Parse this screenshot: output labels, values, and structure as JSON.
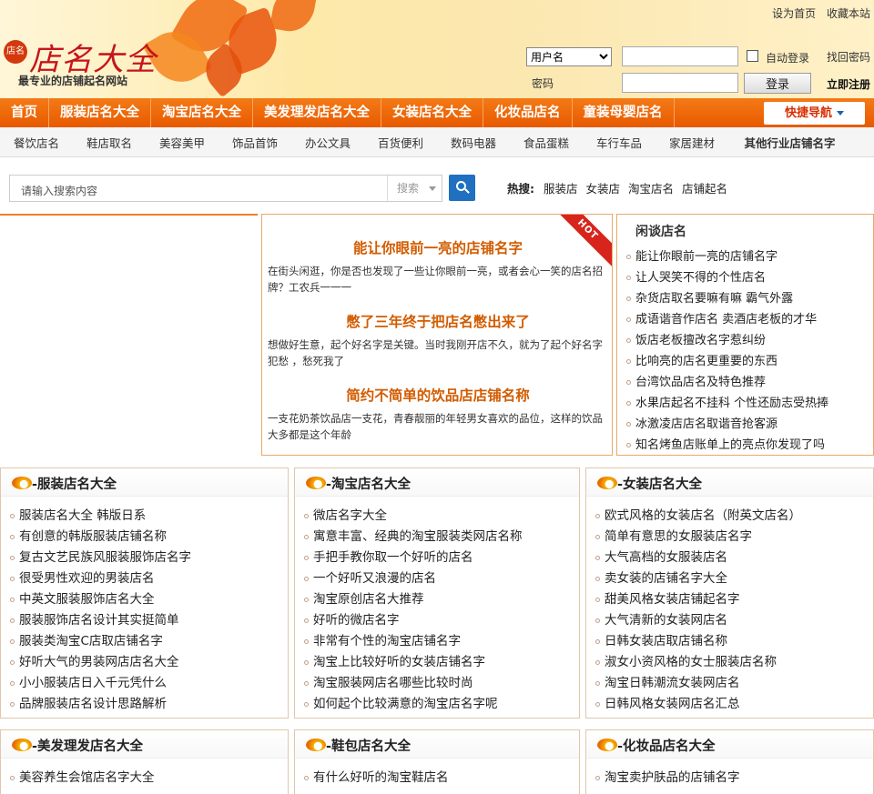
{
  "header": {
    "top_links": [
      "设为首页",
      "收藏本站"
    ],
    "logo": {
      "badge": "店名",
      "title": "店名大全",
      "slogan": "最专业的店铺起名网站"
    },
    "login": {
      "username_select": "用户名",
      "password_label": "密码",
      "auto_login": "自动登录",
      "forgot": "找回密码",
      "login_button": "登录",
      "register": "立即注册"
    }
  },
  "main_nav": {
    "items": [
      "首页",
      "服装店名大全",
      "淘宝店名大全",
      "美发理发店名大全",
      "女装店名大全",
      "化妆品店名",
      "童装母婴店名"
    ],
    "quick_nav": "快捷导航"
  },
  "sub_nav": [
    "餐饮店名",
    "鞋店取名",
    "美容美甲",
    "饰品首饰",
    "办公文具",
    "百货便利",
    "数码电器",
    "食品蛋糕",
    "车行车品",
    "家居建材",
    "其他行业店铺名字"
  ],
  "search": {
    "placeholder": "请输入搜索内容",
    "select": "搜索",
    "hot_label": "热搜:",
    "hot_words": [
      "服装店",
      "女装店",
      "淘宝店名",
      "店铺起名"
    ]
  },
  "feature": {
    "ribbon": "HOT",
    "articles": [
      {
        "title": "能让你眼前一亮的店铺名字",
        "desc": "在街头闲逛，你是否也发现了一些让你眼前一亮，或者会心一笑的店名招牌？工农兵一一一"
      },
      {
        "title": "憋了三年终于把店名憋出来了",
        "desc": "想做好生意，起个好名字是关键。当时我刚开店不久，就为了起个好名字犯愁 ，愁死我了"
      },
      {
        "title": "简约不简单的饮品店店铺名称",
        "desc": "一支花奶茶饮品店一支花，青春靓丽的年轻男女喜欢的品位，这样的饮品大多都是这个年龄"
      }
    ]
  },
  "gossip": {
    "title": "闲谈店名",
    "items": [
      "能让你眼前一亮的店铺名字",
      "让人哭笑不得的个性店名",
      "杂货店取名要嘛有嘛 霸气外露",
      "成语谐音作店名 卖酒店老板的才华",
      "饭店老板擅改名字惹纠纷",
      "比响亮的店名更重要的东西",
      "台湾饮品店名及特色推荐",
      "水果店起名不挂科 个性还励志受热捧",
      "冰激凌店店名取谐音抢客源",
      "知名烤鱼店账单上的亮点你发现了吗"
    ]
  },
  "sections": [
    {
      "title": "-服装店名大全",
      "items": [
        "服装店名大全 韩版日系",
        "有创意的韩版服装店铺名称",
        "复古文艺民族风服装服饰店名字",
        "很受男性欢迎的男装店名",
        "中英文服装服饰店名大全",
        "服装服饰店名设计其实挺简单",
        "服装类淘宝C店取店铺名字",
        "好听大气的男装网店店名大全",
        "小小服装店日入千元凭什么",
        "品牌服装店名设计思路解析"
      ]
    },
    {
      "title": "-淘宝店名大全",
      "items": [
        "微店名字大全",
        "寓意丰富、经典的淘宝服装类网店名称",
        "手把手教你取一个好听的店名",
        "一个好听又浪漫的店名",
        "淘宝原创店名大推荐",
        "好听的微店名字",
        "非常有个性的淘宝店铺名字",
        "淘宝上比较好听的女装店铺名字",
        "淘宝服装网店名哪些比较时尚",
        "如何起个比较满意的淘宝店名字呢"
      ]
    },
    {
      "title": "-女装店名大全",
      "items": [
        "欧式风格的女装店名（附英文店名）",
        "简单有意思的女服装店名字",
        "大气高档的女服装店名",
        "卖女装的店铺名字大全",
        "甜美风格女装店铺起名字",
        "大气清新的女装网店名",
        "日韩女装店取店铺名称",
        "淑女小资风格的女士服装店名称",
        "淘宝日韩潮流女装网店名",
        "日韩风格女装网店名汇总"
      ]
    },
    {
      "title": "-美发理发店名大全",
      "items": [
        "美容养生会馆店名字大全"
      ]
    },
    {
      "title": "-鞋包店名大全",
      "items": [
        "有什么好听的淘宝鞋店名"
      ]
    },
    {
      "title": "-化妆品店名大全",
      "items": [
        "淘宝卖护肤品的店铺名字"
      ]
    }
  ],
  "colors": {
    "nav": "#e85a00",
    "feature_title": "#d25c00",
    "border": "#e9a86b",
    "logo": "#c6141b",
    "search_button": "#1f70c1"
  }
}
